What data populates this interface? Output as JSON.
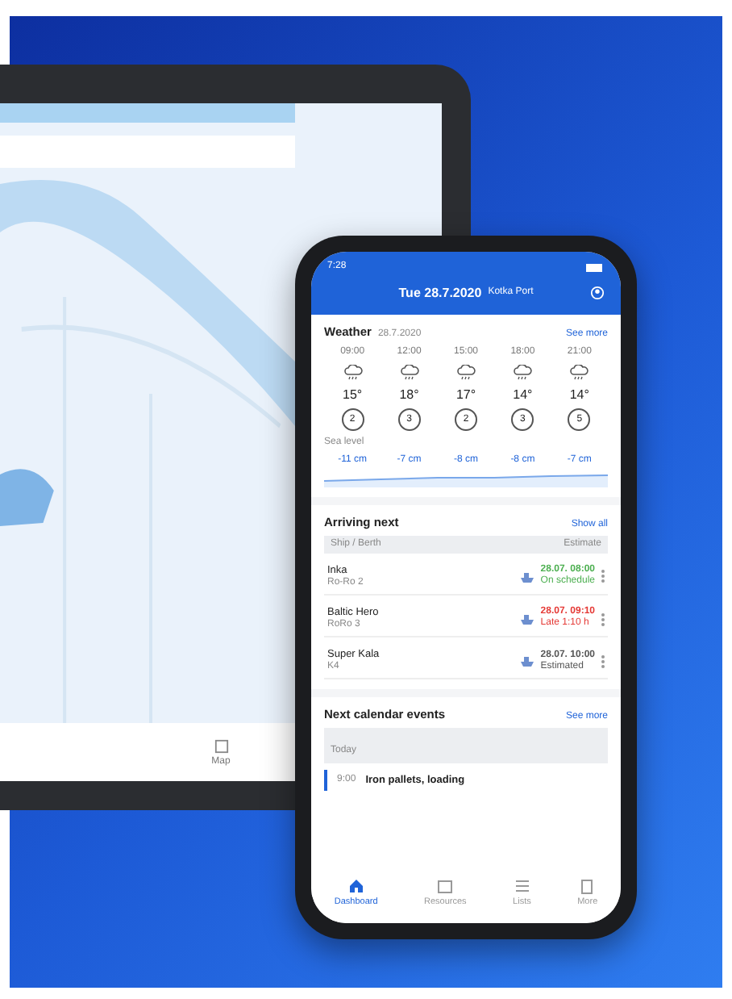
{
  "tablet": {
    "nav_label": "Map"
  },
  "phone": {
    "status_time": "7:28",
    "header": {
      "date": "Tue 28.7.2020",
      "port": "Kotka Port"
    },
    "weather": {
      "title": "Weather",
      "subtitle": "28.7.2020",
      "link": "See more",
      "forecast": [
        {
          "time": "09:00",
          "temp": "15°",
          "wind": "2"
        },
        {
          "time": "12:00",
          "temp": "18°",
          "wind": "3"
        },
        {
          "time": "15:00",
          "temp": "17°",
          "wind": "2"
        },
        {
          "time": "18:00",
          "temp": "14°",
          "wind": "3"
        },
        {
          "time": "21:00",
          "temp": "14°",
          "wind": "5"
        }
      ],
      "wave_label": "Sea level",
      "waves": [
        "-11 cm",
        "-7 cm",
        "-8 cm",
        "-8 cm",
        "-7 cm"
      ]
    },
    "arriving": {
      "title": "Arriving next",
      "link": "Show all",
      "columns": [
        "Ship / Berth",
        "Estimate"
      ],
      "rows": [
        {
          "name": "Inka",
          "berth": "Ro-Ro 2",
          "time": "28.07. 08:00",
          "status": "On schedule",
          "color": "#4caf50"
        },
        {
          "name": "Baltic Hero",
          "berth": "RoRo 3",
          "time": "28.07. 09:10",
          "status": "Late 1:10 h",
          "color": "#e53935"
        },
        {
          "name": "Super Kala",
          "berth": "K4",
          "time": "28.07. 10:00",
          "status": "Estimated",
          "color": "#555555"
        }
      ]
    },
    "calendar": {
      "title": "Next calendar events",
      "link": "See more",
      "day": "Today",
      "events": [
        {
          "time": "9:00",
          "title": "Iron pallets, loading"
        }
      ]
    },
    "nav": [
      {
        "label": "Dashboard",
        "selected": true
      },
      {
        "label": "Resources",
        "selected": false
      },
      {
        "label": "Lists",
        "selected": false
      },
      {
        "label": "More",
        "selected": false
      }
    ]
  }
}
